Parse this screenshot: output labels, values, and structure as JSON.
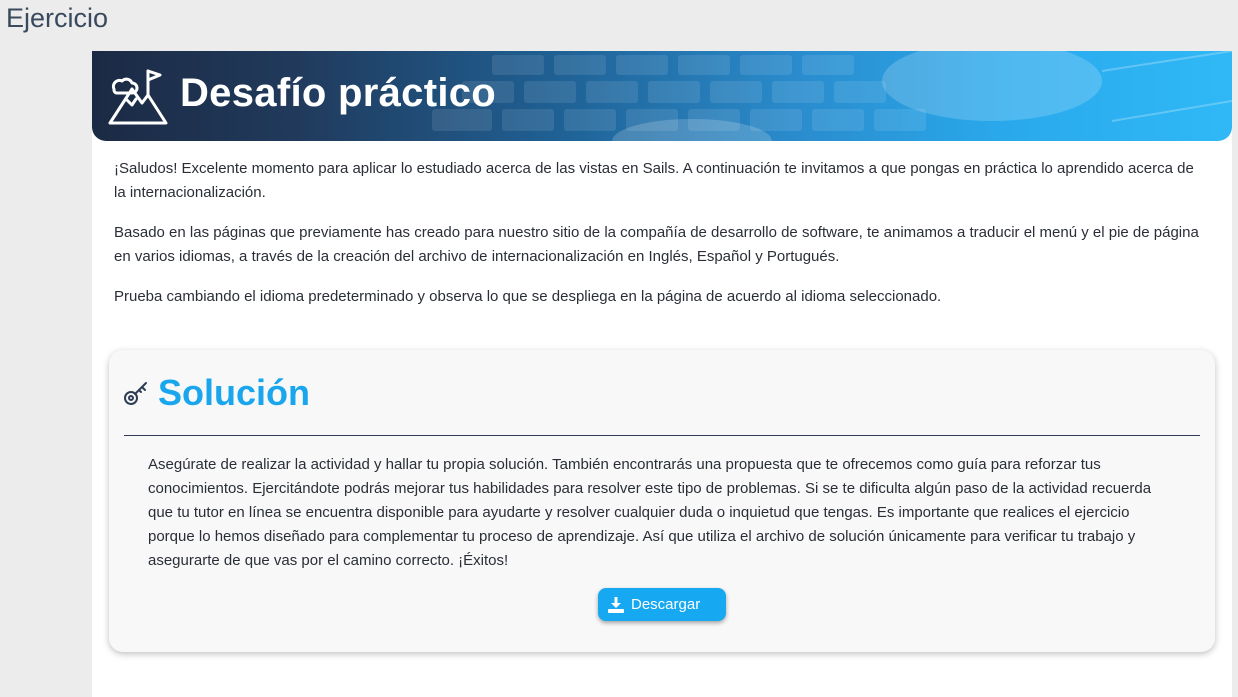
{
  "page": {
    "heading": "Ejercicio"
  },
  "banner": {
    "title": "Desafío práctico",
    "icon": "mountain-flag-icon"
  },
  "intro": {
    "paragraphs": [
      "¡Saludos! Excelente momento para aplicar lo estudiado acerca de las vistas en Sails. A continuación te invitamos a que pongas en práctica lo aprendido acerca de la internacionalización.",
      "Basado en las páginas que previamente has creado para nuestro sitio de la compañía de desarrollo de software, te animamos a traducir el menú y el pie de página en varios idiomas, a través de la creación del archivo de internacionalización en Inglés, Español y Portugués.",
      "Prueba cambiando el idioma predeterminado y observa lo que se despliega en la página de acuerdo al idioma seleccionado."
    ]
  },
  "solution": {
    "icon": "key-icon",
    "title": "Solución",
    "text": "Asegúrate de realizar la actividad y hallar tu propia solución. También encontrarás una propuesta que te ofrecemos como guía para reforzar tus conocimientos. Ejercitándote podrás mejorar tus habilidades para resolver este tipo de problemas. Si se te dificulta algún paso de la actividad recuerda que tu tutor en línea se encuentra disponible para ayudarte y resolver cualquier duda o inquietud que tengas. Es importante que realices el ejercicio porque lo hemos diseñado para complementar tu proceso de aprendizaje. Así que utiliza el archivo de solución únicamente para verificar tu trabajo y asegurarte de que vas por el camino correcto. ¡Éxitos!",
    "download_label": "Descargar",
    "download_icon": "download-icon"
  },
  "colors": {
    "accent": "#1aa6ec",
    "banner_dark": "#1b2a44",
    "divider": "#2e3d55"
  }
}
